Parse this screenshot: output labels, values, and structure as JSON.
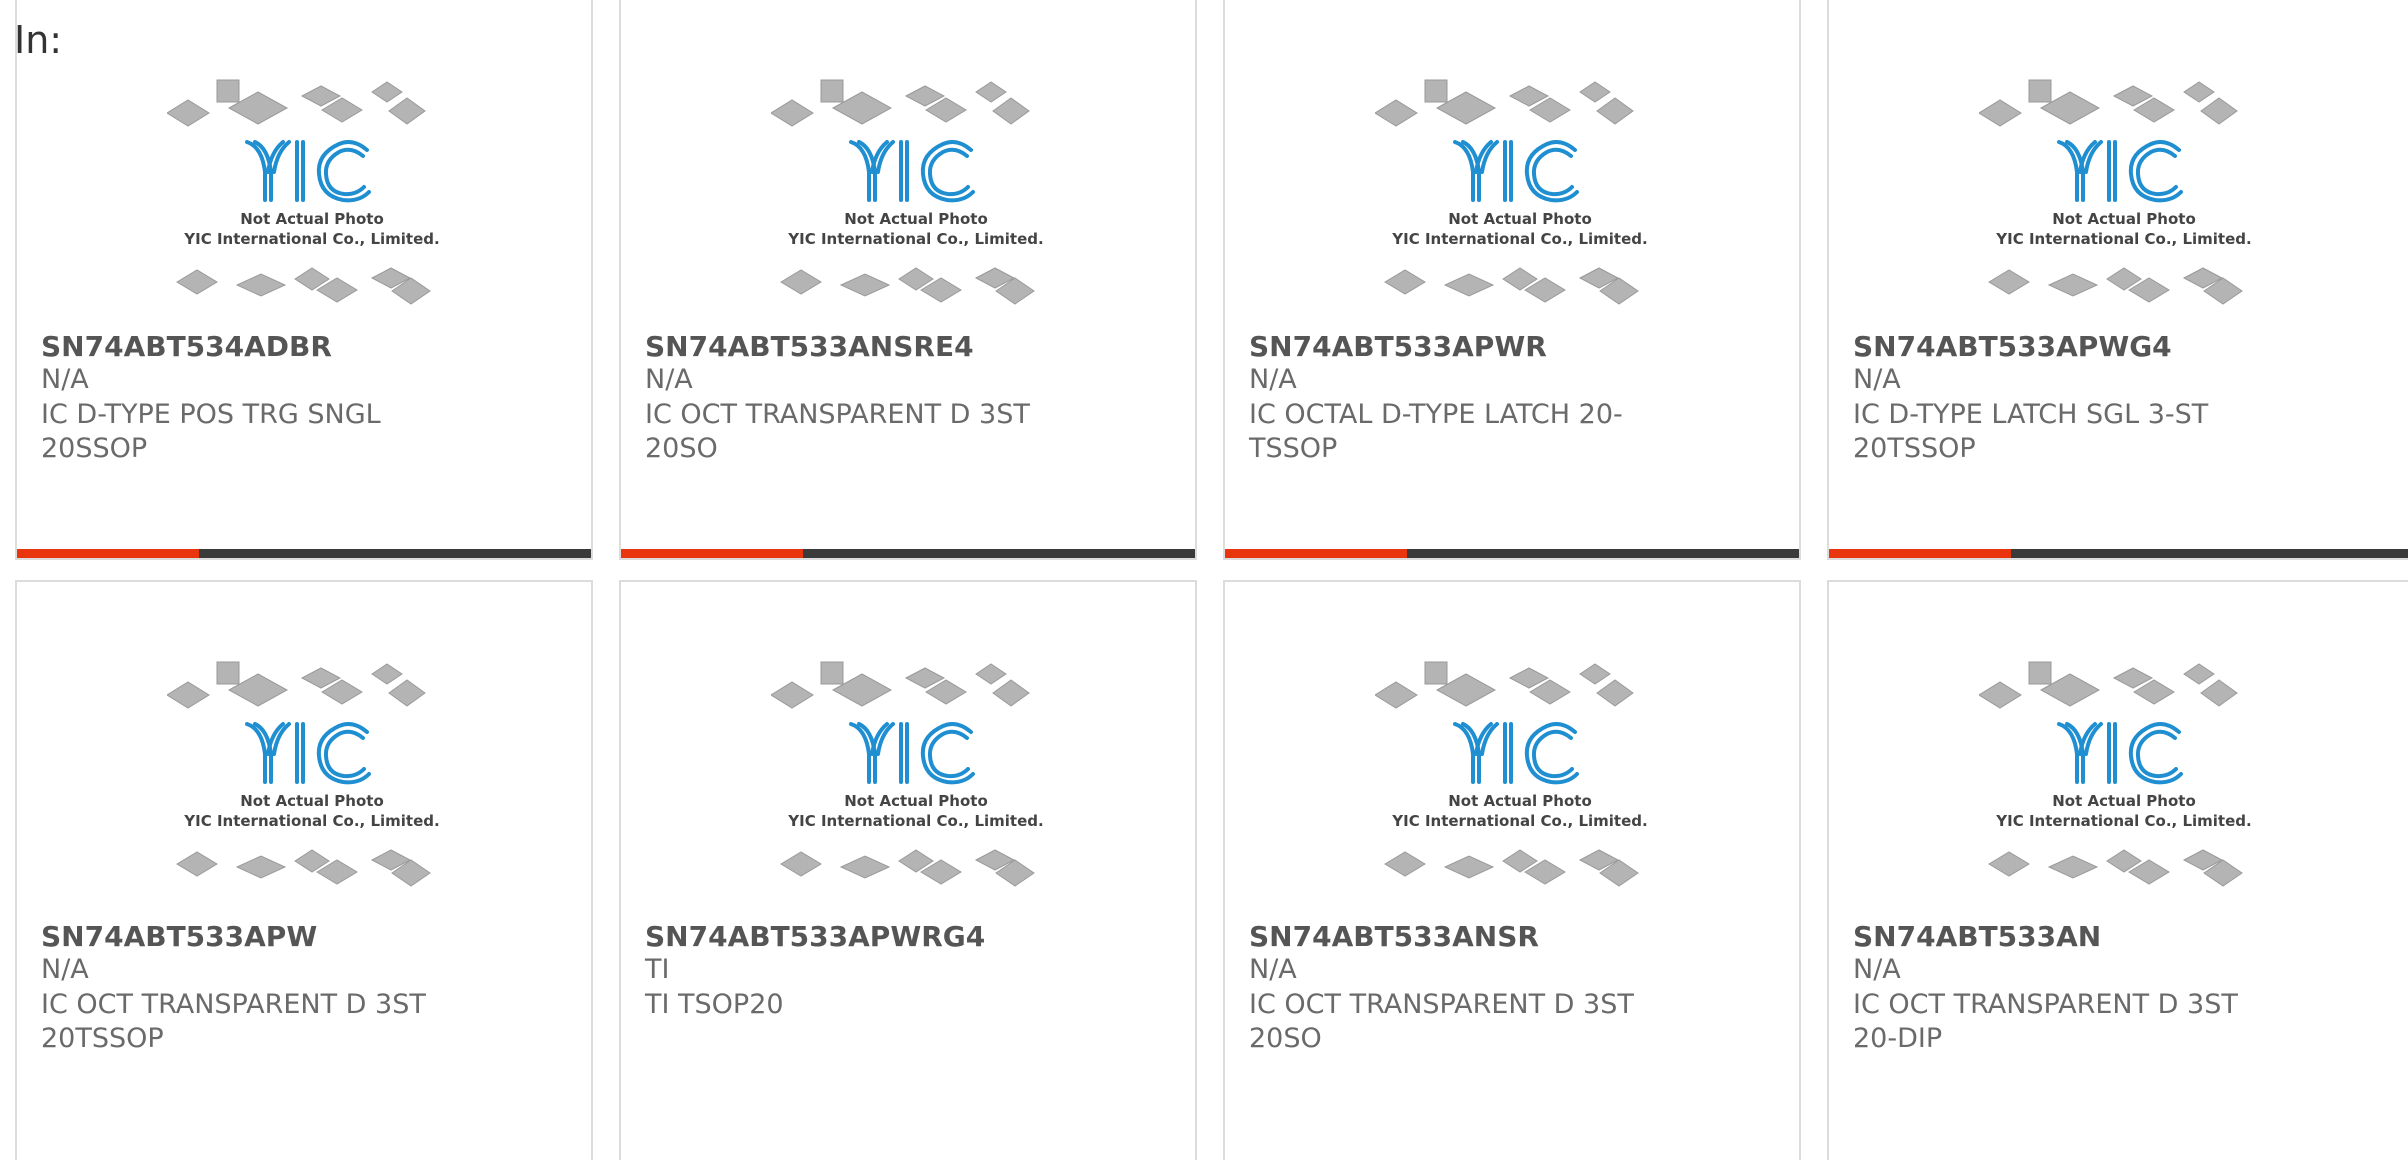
{
  "prefix_label": "In:",
  "photo": {
    "logo": "YIC",
    "line1": "Not Actual Photo",
    "line2": "YIC International Co., Limited."
  },
  "colors": {
    "accent": "#e8350e",
    "bar_dark": "#3a3a3a",
    "logo_blue": "#1f8fd1"
  },
  "products": [
    {
      "part": "SN74ABT534ADBR",
      "mfr": "N/A",
      "desc": "IC D-TYPE POS TRG SNGL 20SSOP"
    },
    {
      "part": "SN74ABT533ANSRE4",
      "mfr": "N/A",
      "desc": "IC OCT TRANSPARENT D 3ST 20SO"
    },
    {
      "part": "SN74ABT533APWR",
      "mfr": "N/A",
      "desc": "IC OCTAL D-TYPE LATCH 20-TSSOP"
    },
    {
      "part": "SN74ABT533APWG4",
      "mfr": "N/A",
      "desc": "IC D-TYPE LATCH SGL 3-ST 20TSSOP"
    },
    {
      "part": "SN74ABT533APW",
      "mfr": "N/A",
      "desc": "IC OCT TRANSPARENT D 3ST 20TSSOP"
    },
    {
      "part": "SN74ABT533APWRG4",
      "mfr": "TI",
      "desc": "TI TSOP20"
    },
    {
      "part": "SN74ABT533ANSR",
      "mfr": "N/A",
      "desc": "IC OCT TRANSPARENT D 3ST 20SO"
    },
    {
      "part": "SN74ABT533AN",
      "mfr": "N/A",
      "desc": "IC OCT TRANSPARENT D 3ST 20-DIP"
    }
  ]
}
